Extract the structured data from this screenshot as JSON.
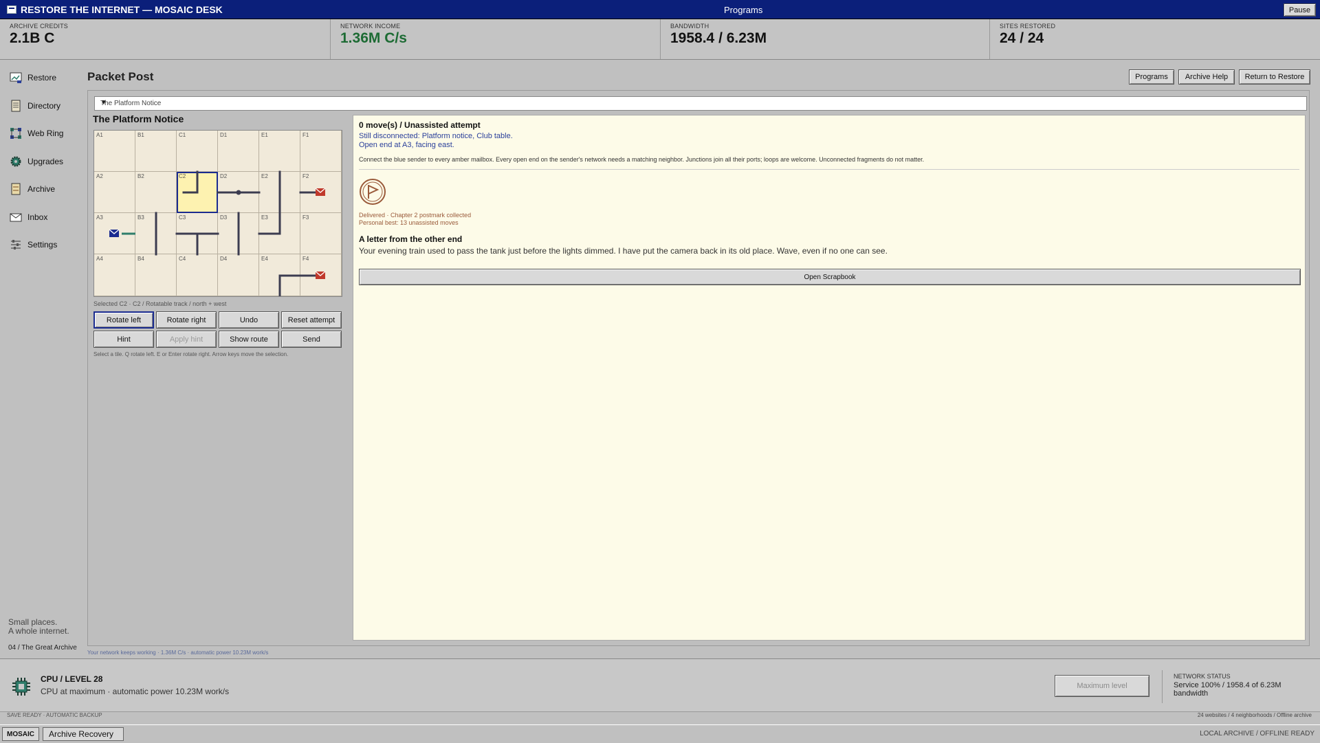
{
  "window": {
    "title": "RESTORE THE INTERNET — MOSAIC DESK",
    "center_title": "Programs",
    "pause_label": "Pause"
  },
  "stats": [
    {
      "label": "ARCHIVE CREDITS",
      "value": "2.1B C"
    },
    {
      "label": "NETWORK INCOME",
      "value": "1.36M C/s"
    },
    {
      "label": "BANDWIDTH",
      "value": "1958.4 / 6.23M"
    },
    {
      "label": "SITES RESTORED",
      "value": "24 / 24"
    }
  ],
  "sidebar": {
    "items": [
      {
        "label": "Restore",
        "icon": "restore-icon"
      },
      {
        "label": "Directory",
        "icon": "directory-icon"
      },
      {
        "label": "Web Ring",
        "icon": "web-ring-icon"
      },
      {
        "label": "Upgrades",
        "icon": "gear-icon"
      },
      {
        "label": "Archive",
        "icon": "archive-icon"
      },
      {
        "label": "Inbox",
        "icon": "mail-icon"
      },
      {
        "label": "Settings",
        "icon": "sliders-icon"
      }
    ],
    "tagline_1": "Small places.",
    "tagline_2": "A whole internet.",
    "archive_id": "04 / The Great Archive"
  },
  "main": {
    "title": "Packet Post",
    "buttons": {
      "programs": "Programs",
      "help": "Archive Help",
      "return": "Return to Restore"
    },
    "puzzle_select": "The Platform Notice",
    "puzzle_name": "The Platform Notice",
    "grid": {
      "columns": [
        "A",
        "B",
        "C",
        "D",
        "E",
        "F"
      ],
      "rows": [
        "1",
        "2",
        "3",
        "4"
      ],
      "selected": "C2",
      "colors": {
        "track": "#3c3c50",
        "sender": "#1a2b8f",
        "mailbox": "#c0392b",
        "connector": "#2e7d6b"
      }
    },
    "selected_info": "Selected C2 · C2 / Rotatable track / north + west",
    "buttons_grid": {
      "rotate_left": "Rotate left",
      "rotate_right": "Rotate right",
      "undo": "Undo",
      "reset": "Reset attempt",
      "hint": "Hint",
      "apply_hint": "Apply hint",
      "show_route": "Show route",
      "send": "Send"
    },
    "controls_hint": "Select a tile. Q rotate left. E or Enter rotate right. Arrow keys move the selection.",
    "info": {
      "move_status": "0 move(s) / Unassisted attempt",
      "disconnected": "Still disconnected: Platform notice, Club table.",
      "open_end": "Open end at A3, facing east.",
      "rules": "Connect the blue sender to every amber mailbox. Every open end on the sender's network needs a matching neighbor. Junctions join all their ports; loops are welcome. Unconnected fragments do not matter.",
      "delivered": "Delivered · Chapter 2 postmark collected",
      "personal_best": "Personal best: 13 unassisted moves",
      "letter_title": "A letter from the other end",
      "letter_body": "Your evening train used to pass the tank just before the lights dimmed. I have put the camera back in its old place. Wave, even if no one can see.",
      "scrapbook": "Open Scrapbook"
    },
    "network_note": "Your network keeps working · 1.36M C/s · automatic power 10.23M work/s"
  },
  "bottom": {
    "cpu_title": "CPU / LEVEL 28",
    "cpu_desc": "CPU at maximum · automatic power 10.23M work/s",
    "max_level": "Maximum level",
    "network_label": "NETWORK STATUS",
    "network_text": "Service 100% / 1958.4 of 6.23M bandwidth"
  },
  "footer": {
    "save": "SAVE READY · AUTOMATIC BACKUP",
    "summary": "24 websites / 4 neighborhoods / Offline archive",
    "task_mosaic": "MOSAIC",
    "task_archive": "Archive Recovery",
    "status": "LOCAL ARCHIVE / OFFLINE READY"
  }
}
